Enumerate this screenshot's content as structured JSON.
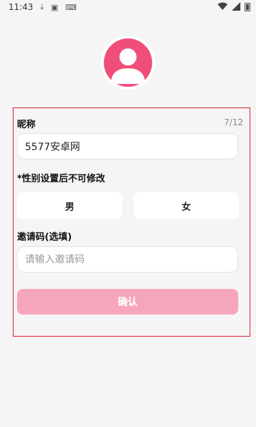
{
  "status_bar": {
    "time": "11:43",
    "icons": [
      "download-icon",
      "app-icon",
      "keyboard-icon"
    ]
  },
  "colors": {
    "accent": "#f04e7a",
    "confirm_disabled": "#f6a6ba",
    "highlight_border": "#d91e2f"
  },
  "form": {
    "nickname": {
      "label": "昵称",
      "counter": "7/12",
      "value": "5577安卓网"
    },
    "gender": {
      "label": "*性别设置后不可修改",
      "options": [
        "男",
        "女"
      ]
    },
    "invite": {
      "label": "邀请码(选填)",
      "placeholder": "请输入邀请码"
    },
    "confirm_label": "确认"
  }
}
